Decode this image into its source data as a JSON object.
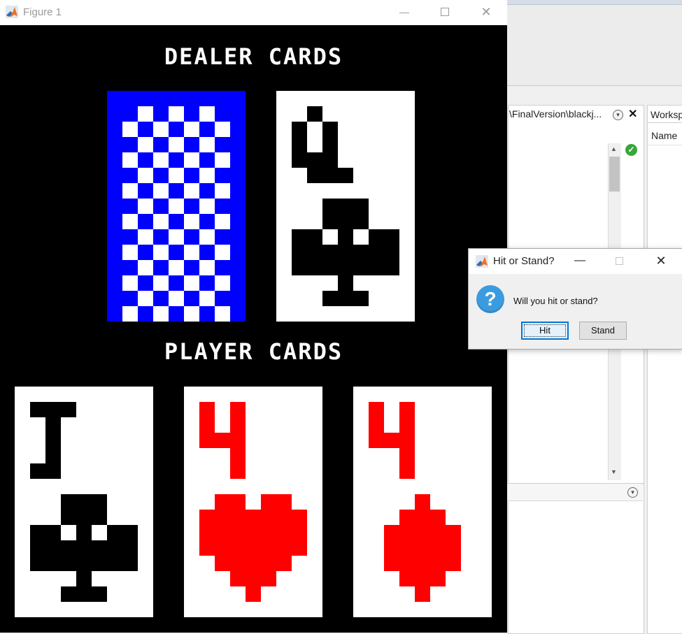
{
  "figure": {
    "title": "Figure 1",
    "dealer_label": "DEALER CARDS",
    "player_label": "PLAYER CARDS",
    "dealer_cards": [
      {
        "face": "back",
        "back_colors": [
          "#0000ff",
          "#ffffff"
        ]
      },
      {
        "rank": "Q",
        "suit": "clubs",
        "color": "#000000"
      }
    ],
    "player_cards": [
      {
        "rank": "J",
        "suit": "clubs",
        "color": "#000000"
      },
      {
        "rank": "4",
        "suit": "hearts",
        "color": "#ff0000"
      },
      {
        "rank": "4",
        "suit": "diamonds",
        "color": "#ff0000"
      }
    ]
  },
  "dialog": {
    "title": "Hit or Stand?",
    "message": "Will you hit or stand?",
    "buttons": {
      "hit": "Hit",
      "stand": "Stand"
    },
    "icon": "question-icon"
  },
  "desktop": {
    "current_folder_path": "\\FinalVersion\\blackj...",
    "workspace_tab": "Worksp",
    "workspace_column": "Name"
  }
}
